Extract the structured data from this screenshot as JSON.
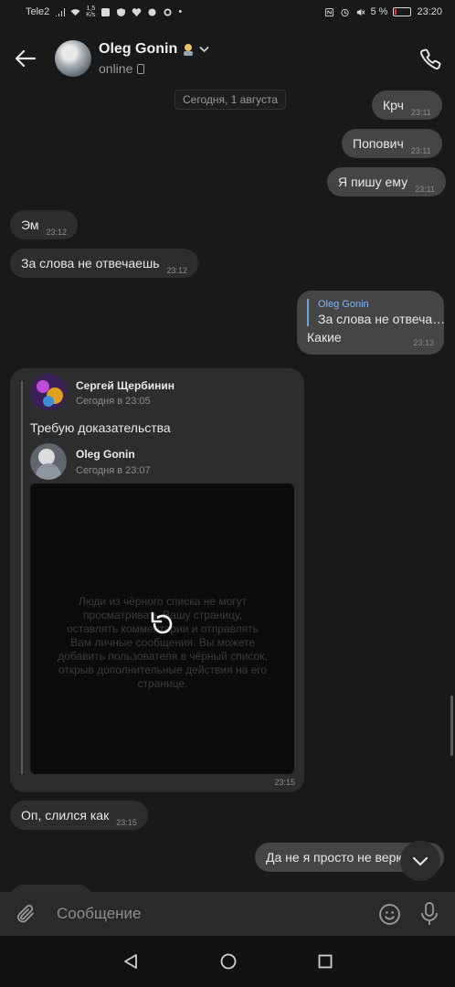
{
  "status_bar": {
    "carrier": "Tele2",
    "speed_value": "1,5",
    "speed_unit": "K/s",
    "battery": "5 %",
    "battery_level": 0.05,
    "time": "23:20"
  },
  "header": {
    "name": "Oleg Gonin",
    "status": "online"
  },
  "chat": {
    "date_chip": "Сегодня, 1 августа",
    "messages": [
      {
        "text": "Крч",
        "time": "23:11"
      },
      {
        "text": "Попович",
        "time": "23:11"
      },
      {
        "text": "Я пишу ему",
        "time": "23:11"
      },
      {
        "text": "Эм",
        "time": "23:12"
      },
      {
        "text": "За слова не отвечаешь",
        "time": "23:12"
      },
      {
        "reply_name": "Oleg Gonin",
        "reply_text": "За слова не отвеча…",
        "text": "Какие",
        "time": "23:13"
      },
      {
        "text": "Оп, слился как",
        "time": "23:15"
      },
      {
        "text": "Да не я просто не верю",
        "time": ""
      }
    ],
    "forwarded": {
      "author1": "Сергей Щербинин",
      "date1": "Сегодня в 23:05",
      "text1": "Требую доказательства",
      "author2": "Oleg Gonin",
      "date2": "Сегодня в 23:07",
      "media_text": "Люди из чёрного списка не могут просматривать Вашу страницу, оставлять комментарии и отправлять Вам личные сообщения. Вы можете добавить пользователя в чёрный список, открыв дополнительные действия на его странице.",
      "time": "23:15"
    }
  },
  "composer": {
    "placeholder": "Сообщение"
  },
  "icons": [
    "back-arrow-icon",
    "phone-icon",
    "paperclip-icon",
    "emoji-icon",
    "microphone-icon",
    "chevron-down-icon",
    "replay-icon"
  ],
  "colors": {
    "background": "#191919",
    "outgoing": "#454546",
    "incoming": "#2d2d2f",
    "link": "#7fb3ff"
  }
}
